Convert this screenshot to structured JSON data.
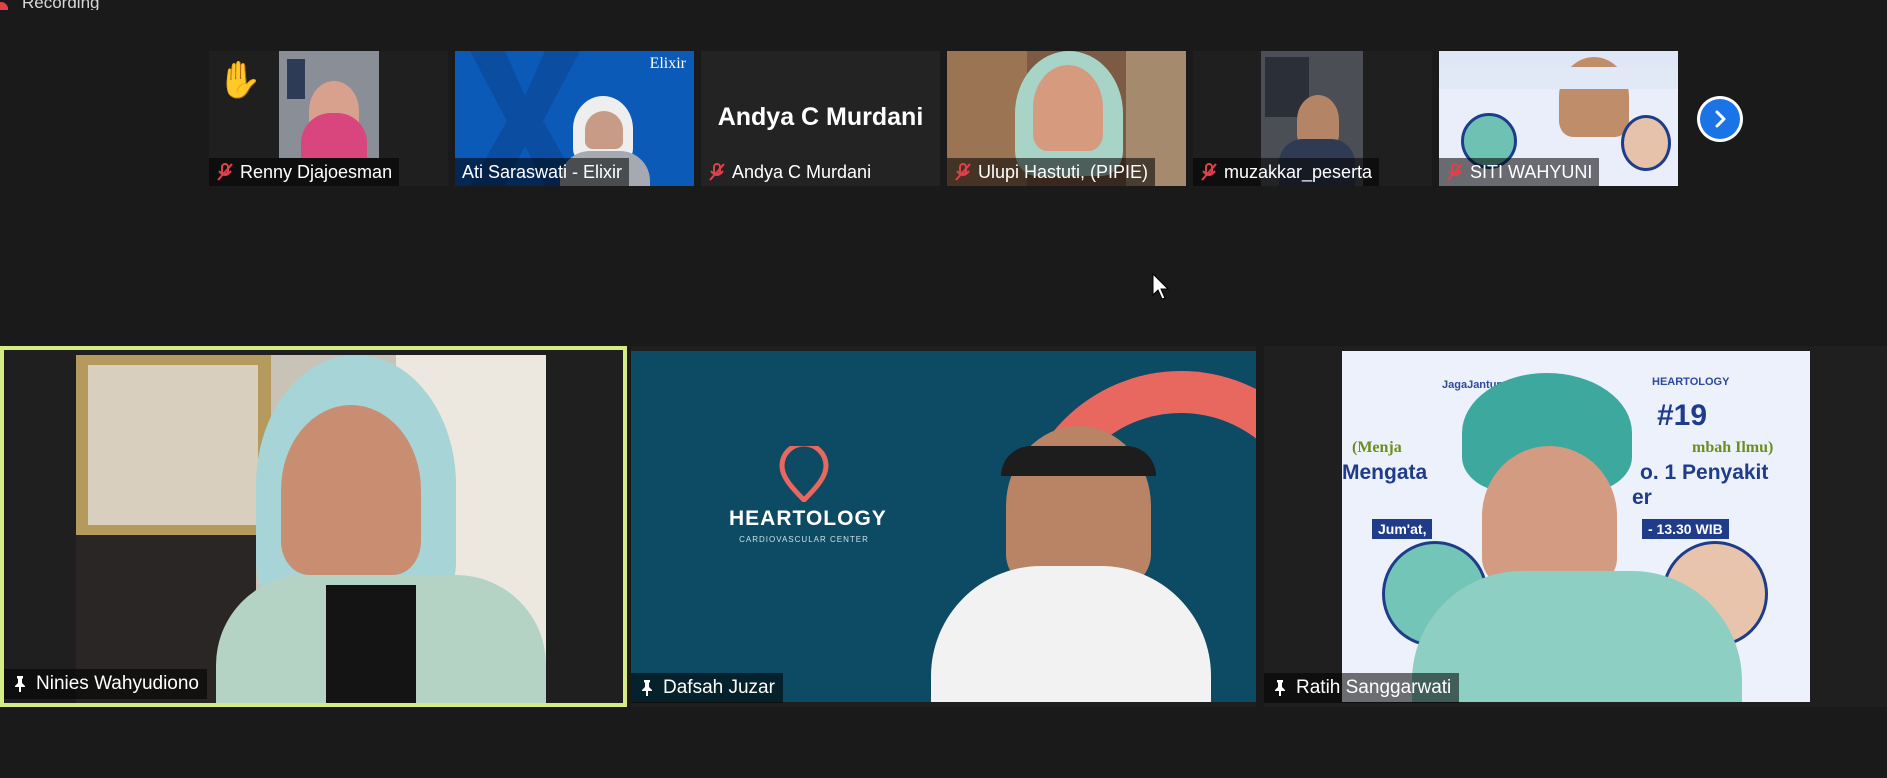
{
  "recording": {
    "label": "Recording"
  },
  "strip": {
    "participants": [
      {
        "name": "Renny Djajoesman",
        "muted": true,
        "hand_raised": true
      },
      {
        "name": "Ati Saraswati - Elixir",
        "muted": false,
        "logo": "Elixir"
      },
      {
        "name": "Andya C Murdani",
        "muted": true,
        "video_off_name": "Andya C Murdani"
      },
      {
        "name": "Ulupi Hastuti, (PIPIE)",
        "muted": true
      },
      {
        "name": "muzakkar_peserta",
        "muted": true
      },
      {
        "name": "SITI WAHYUNI",
        "muted": true
      }
    ],
    "next_icon": "chevron-right-icon"
  },
  "gallery": {
    "tiles": [
      {
        "name": "Ninies Wahyudiono",
        "active": true
      },
      {
        "name": "Dafsah Juzar",
        "brand": "HEARTOLOGY",
        "brand_sub": "CARDIOVASCULAR CENTER"
      },
      {
        "name": "Ratih Sanggarwati",
        "poster": {
          "hashtag": "#19",
          "left_brand": "JagaJantung",
          "right_brand": "HEARTOLOGY",
          "line1_left": "(Menja",
          "line1_right": "mbah Ilmu)",
          "line2_left": "Mengata",
          "line2_right": "o. 1 Penyakit",
          "line3": "er",
          "date_left": "Jum'at,",
          "date_right": "- 13.30 WIB"
        }
      }
    ]
  },
  "colors": {
    "active_border": "#d5ec86",
    "next_button": "#1b73e8",
    "muted_icon": "#e0414b",
    "brand_bg": "#0d4a63"
  }
}
